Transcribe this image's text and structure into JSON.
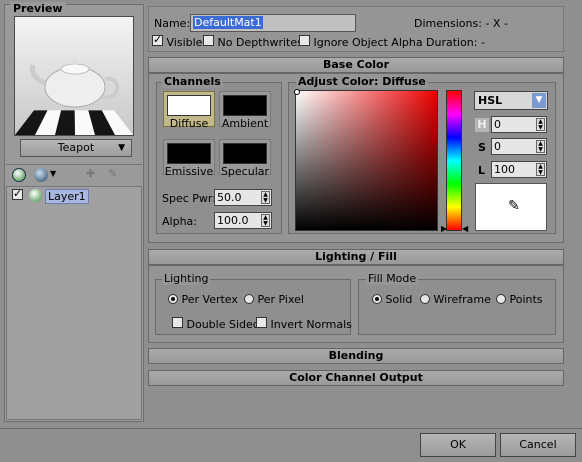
{
  "preview": {
    "title": "Preview",
    "model_button": "Teapot"
  },
  "layers": [
    {
      "label": "Layer1",
      "visible": true
    }
  ],
  "header": {
    "name_label": "Name:",
    "name_value": "DefaultMat1",
    "visible_label": "Visible",
    "no_depth_label": "No Depthwrites",
    "ignore_alpha_label": "Ignore Object Alpha",
    "dimensions_label": "Dimensions: - X -",
    "duration_label": "Duration: -"
  },
  "base_color": {
    "title": "Base Color",
    "channels_title": "Channels",
    "channels": [
      {
        "label": "Diffuse"
      },
      {
        "label": "Ambient"
      },
      {
        "label": "Emissive"
      },
      {
        "label": "Specular"
      }
    ],
    "spec_pwr_label": "Spec Pwr:",
    "spec_pwr_value": "50.0",
    "alpha_label": "Alpha:",
    "alpha_value": "100.0",
    "adjust_title": "Adjust Color: Diffuse",
    "mode": "HSL",
    "h_label": "H",
    "h_value": "0",
    "s_label": "S",
    "s_value": "0",
    "l_label": "L",
    "l_value": "100"
  },
  "lighting": {
    "title": "Lighting / Fill",
    "lighting_group": "Lighting",
    "per_vertex": "Per Vertex",
    "per_pixel": "Per Pixel",
    "double_sided": "Double Sided",
    "invert_normals": "Invert Normals",
    "fill_group": "Fill Mode",
    "solid": "Solid",
    "wireframe": "Wireframe",
    "points": "Points"
  },
  "blending": {
    "title": "Blending"
  },
  "color_output": {
    "title": "Color Channel Output"
  },
  "footer": {
    "ok": "OK",
    "cancel": "Cancel"
  }
}
